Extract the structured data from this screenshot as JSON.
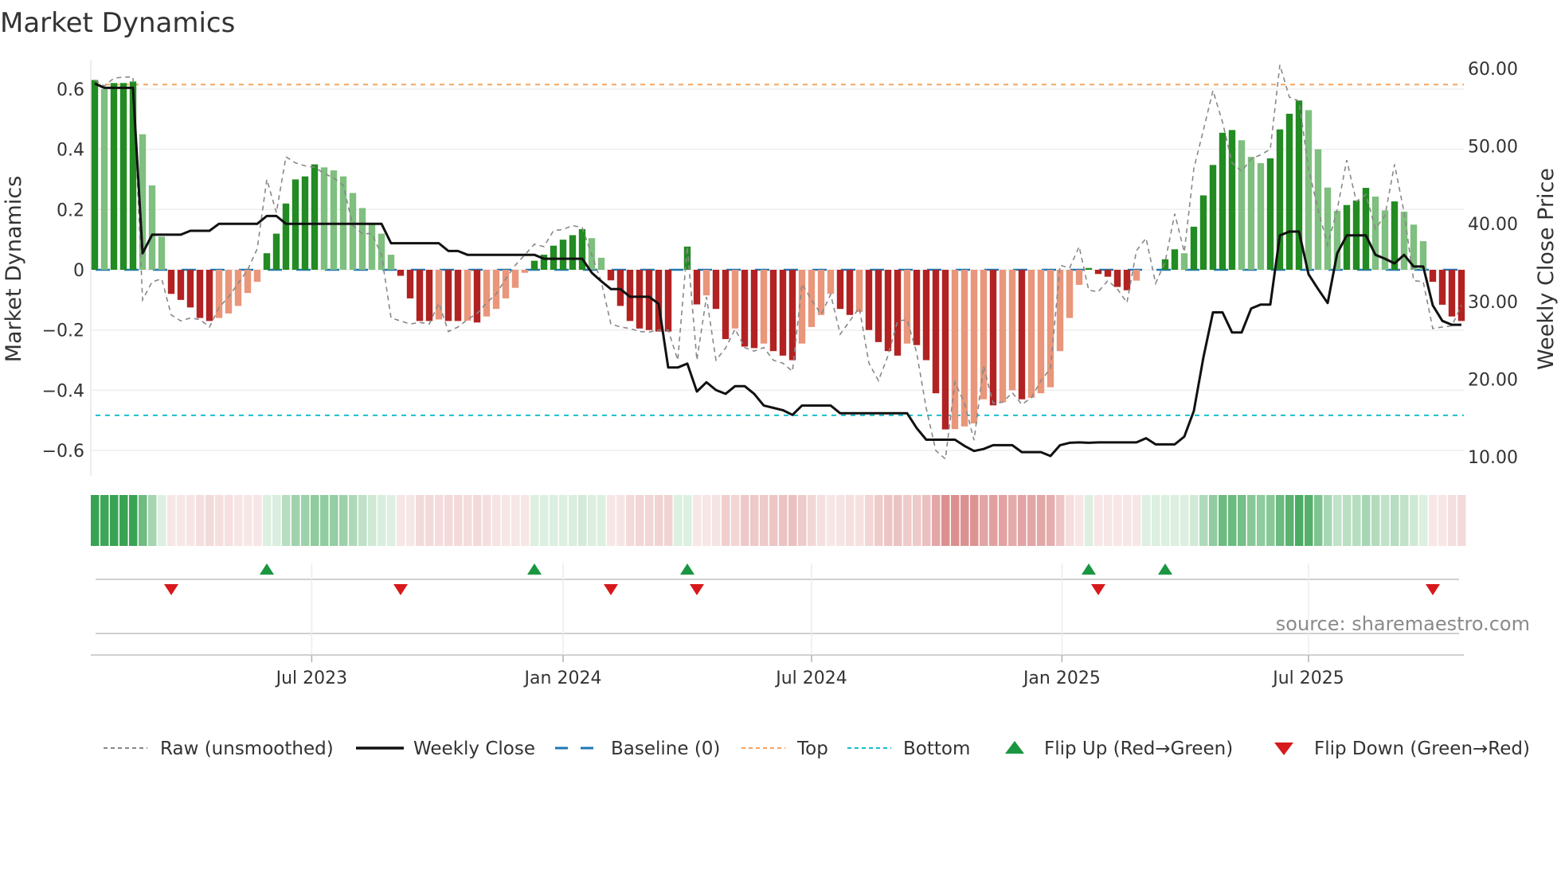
{
  "title": "Market Dynamics",
  "source": "source: sharemaestro.com",
  "colors": {
    "green_dark": "#228b22",
    "green_light": "#7fbf7f",
    "red_dark": "#b22222",
    "red_light": "#e9967a",
    "close": "#111111",
    "raw": "#888888",
    "baseline": "#1f77b4",
    "top": "#f4a460",
    "bottom": "#17becf",
    "flip_up": "#1a9641",
    "flip_down": "#d7191c",
    "strip_green": "#2e9e4a",
    "strip_red": "#c85050"
  },
  "chart_data": {
    "type": "bar",
    "title": "Market Dynamics",
    "ylabel": "Market Dynamics",
    "y2label": "Weekly Close Price",
    "ylim": [
      -0.69,
      0.69
    ],
    "y2lim": [
      6.3,
      61.0
    ],
    "yticks": [
      {
        "v": 0.6,
        "label": "0.6"
      },
      {
        "v": 0.4,
        "label": "0.4"
      },
      {
        "v": 0.2,
        "label": "0.2"
      },
      {
        "v": 0,
        "label": "0"
      },
      {
        "v": -0.2,
        "label": "−0.2"
      },
      {
        "v": -0.4,
        "label": "−0.4"
      },
      {
        "v": -0.6,
        "label": "−0.6"
      }
    ],
    "y2ticks": [
      {
        "v": 60,
        "label": "60.00"
      },
      {
        "v": 50,
        "label": "50.00"
      },
      {
        "v": 40,
        "label": "40.00"
      },
      {
        "v": 30,
        "label": "30.00"
      },
      {
        "v": 20,
        "label": "20.00"
      },
      {
        "v": 10,
        "label": "10.00"
      }
    ],
    "x_unit": "week index",
    "xticks": [
      {
        "week": 22.7,
        "label": "Jul 2023"
      },
      {
        "week": 49.0,
        "label": "Jan 2024"
      },
      {
        "week": 75.0,
        "label": "Jul 2024"
      },
      {
        "week": 101.2,
        "label": "Jan 2025"
      },
      {
        "week": 127.0,
        "label": "Jul 2025"
      }
    ],
    "top": 0.615,
    "bottom": -0.483,
    "baseline": 0,
    "dynamics": [
      0.63,
      0.6,
      0.62,
      0.62,
      0.625,
      0.45,
      0.28,
      0.11,
      -0.08,
      -0.1,
      -0.125,
      -0.16,
      -0.17,
      -0.16,
      -0.145,
      -0.12,
      -0.077,
      -0.04,
      0.055,
      0.12,
      0.22,
      0.3,
      0.31,
      0.35,
      0.34,
      0.33,
      0.31,
      0.255,
      0.205,
      0.15,
      0.12,
      0.05,
      -0.02,
      -0.095,
      -0.17,
      -0.17,
      -0.165,
      -0.17,
      -0.17,
      -0.169,
      -0.175,
      -0.155,
      -0.13,
      -0.095,
      -0.06,
      -0.01,
      0.03,
      0.05,
      0.08,
      0.1,
      0.115,
      0.135,
      0.105,
      0.04,
      -0.035,
      -0.12,
      -0.17,
      -0.195,
      -0.2,
      -0.205,
      -0.205,
      0,
      0.077,
      -0.115,
      -0.085,
      -0.13,
      -0.23,
      -0.195,
      -0.255,
      -0.26,
      -0.245,
      -0.27,
      -0.285,
      -0.3,
      -0.245,
      -0.19,
      -0.15,
      -0.08,
      -0.13,
      -0.15,
      -0.14,
      -0.2,
      -0.24,
      -0.27,
      -0.285,
      -0.245,
      -0.25,
      -0.3,
      -0.41,
      -0.53,
      -0.529,
      -0.52,
      -0.51,
      -0.43,
      -0.45,
      -0.44,
      -0.4,
      -0.43,
      -0.425,
      -0.41,
      -0.39,
      -0.27,
      -0.16,
      -0.05,
      0.006,
      -0.014,
      -0.023,
      -0.057,
      -0.068,
      -0.036,
      0,
      0,
      0.035,
      0.068,
      0.055,
      0.143,
      0.247,
      0.348,
      0.455,
      0.464,
      0.43,
      0.375,
      0.354,
      0.37,
      0.466,
      0.518,
      0.562,
      0.53,
      0.4,
      0.273,
      0.196,
      0.215,
      0.23,
      0.272,
      0.243,
      0.197,
      0.227,
      0.193,
      0.15,
      0.095,
      -0.04,
      -0.116,
      -0.155,
      -0.17
    ],
    "raw": [
      0.63,
      0.61,
      0.636,
      0.64,
      0.64,
      -0.1,
      -0.04,
      -0.03,
      -0.15,
      -0.17,
      -0.16,
      -0.165,
      -0.19,
      -0.125,
      -0.09,
      -0.045,
      0,
      0.07,
      0.3,
      0.19,
      0.375,
      0.355,
      0.345,
      0.34,
      0.32,
      0.305,
      0.28,
      0.147,
      0.12,
      0.12,
      0.05,
      -0.16,
      -0.17,
      -0.18,
      -0.175,
      -0.18,
      -0.11,
      -0.205,
      -0.19,
      -0.165,
      -0.145,
      -0.11,
      -0.08,
      -0.03,
      0.015,
      0.05,
      0.085,
      0.077,
      0.13,
      0.134,
      0.147,
      0.14,
      0.05,
      -0.04,
      -0.18,
      -0.19,
      -0.195,
      -0.205,
      -0.207,
      -0.2,
      -0.2,
      -0.3,
      0.077,
      -0.3,
      -0.09,
      -0.3,
      -0.26,
      -0.197,
      -0.258,
      -0.27,
      -0.258,
      -0.3,
      -0.31,
      -0.337,
      -0.047,
      -0.1,
      -0.148,
      -0.082,
      -0.214,
      -0.17,
      -0.126,
      -0.31,
      -0.368,
      -0.285,
      -0.17,
      -0.166,
      -0.276,
      -0.46,
      -0.6,
      -0.628,
      -0.373,
      -0.443,
      -0.566,
      -0.32,
      -0.443,
      -0.44,
      -0.408,
      -0.447,
      -0.425,
      -0.368,
      -0.328,
      0.015,
      0.006,
      0.077,
      -0.068,
      -0.073,
      -0.036,
      -0.064,
      -0.109,
      0.064,
      0.105,
      -0.045,
      0.027,
      0.186,
      0.059,
      0.336,
      0.464,
      0.595,
      0.49,
      0.355,
      0.327,
      0.368,
      0.382,
      0.4,
      0.68,
      0.573,
      0.56,
      0.336,
      0.2,
      0.082,
      0.2,
      0.364,
      0.227,
      0.25,
      0.136,
      0.18,
      0.35,
      0.19,
      -0.036,
      -0.04,
      -0.195,
      -0.19,
      -0.186,
      -0.118
    ],
    "close": [
      58.05,
      57.5,
      57.5,
      57.5,
      57.5,
      36.2,
      38.6,
      38.6,
      38.6,
      38.6,
      39.1,
      39.1,
      39.1,
      40.0,
      40.0,
      40.0,
      40.0,
      40.0,
      41.0,
      41.0,
      40.0,
      40.0,
      40.0,
      40.0,
      40.0,
      40.0,
      40.0,
      40.0,
      40.0,
      40.0,
      40.0,
      37.5,
      37.5,
      37.5,
      37.5,
      37.5,
      37.5,
      36.5,
      36.5,
      36.0,
      36.0,
      36.0,
      36.0,
      36.0,
      36.0,
      36.0,
      36.0,
      35.5,
      35.5,
      35.5,
      35.5,
      35.5,
      33.7,
      32.6,
      31.6,
      31.6,
      30.6,
      30.6,
      30.6,
      29.7,
      21.5,
      21.5,
      22.0,
      18.4,
      19.6,
      18.6,
      18.1,
      19.1,
      19.1,
      18.1,
      16.6,
      16.3,
      16.0,
      15.4,
      16.6,
      16.6,
      16.6,
      16.6,
      15.6,
      15.6,
      15.6,
      15.6,
      15.6,
      15.6,
      15.6,
      15.6,
      13.7,
      12.2,
      12.2,
      12.2,
      12.2,
      11.4,
      10.75,
      11.0,
      11.5,
      11.5,
      11.5,
      10.6,
      10.6,
      10.6,
      10.1,
      11.5,
      11.8,
      11.85,
      11.8,
      11.85,
      11.85,
      11.85,
      11.85,
      11.85,
      12.4,
      11.6,
      11.6,
      11.6,
      12.6,
      15.9,
      22.8,
      28.6,
      28.6,
      26.0,
      26.0,
      29.1,
      29.6,
      29.6,
      38.5,
      39.0,
      39.0,
      33.5,
      31.6,
      29.8,
      36.2,
      38.5,
      38.5,
      38.5,
      36.0,
      35.5,
      34.9,
      36.0,
      34.5,
      34.5,
      29.5,
      27.5,
      27.0,
      27.0
    ],
    "flips_up": [
      18,
      46,
      62,
      104,
      112
    ],
    "flips_down": [
      8,
      32,
      54,
      63,
      105,
      140
    ],
    "legend": {
      "position": "bottom",
      "items": [
        {
          "key": "raw",
          "label": "Raw (unsmoothed)"
        },
        {
          "key": "close",
          "label": "Weekly Close"
        },
        {
          "key": "baseline",
          "label": "Baseline (0)"
        },
        {
          "key": "top",
          "label": "Top"
        },
        {
          "key": "bottom",
          "label": "Bottom"
        },
        {
          "key": "flip_up",
          "label": "Flip Up (Red→Green)"
        },
        {
          "key": "flip_down",
          "label": "Flip Down (Green→Red)"
        }
      ]
    }
  }
}
